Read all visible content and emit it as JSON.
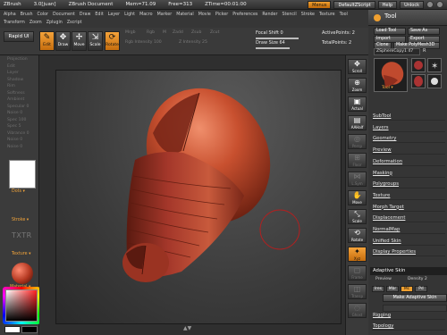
{
  "titlebar": {
    "segments": [
      "ZBrush",
      "3.0[juan]",
      "ZBrush Document",
      "Mem=71.09",
      "Free=313",
      "ZTime=00:01:00"
    ],
    "menus_btn": "Menus",
    "script_btn": "DefaultZScript",
    "help_btn": "Help",
    "unlock_btn": "Unlock"
  },
  "menubar": {
    "items": [
      "Alpha",
      "Brush",
      "Color",
      "Document",
      "Draw",
      "Edit",
      "Layer",
      "Light",
      "Macro",
      "Marker",
      "Material",
      "Movie",
      "Picker",
      "Preferences",
      "Render",
      "Stencil",
      "Stroke",
      "Texture",
      "Tool",
      "Transform",
      "Zoom",
      "Zplugin",
      "Zscript"
    ]
  },
  "shelf": {
    "rapid_ui": "Rapid UI",
    "tools": [
      {
        "label": "Edit",
        "icon": "pencil-icon",
        "glyph": "✎"
      },
      {
        "label": "Draw",
        "icon": "draw-icon",
        "glyph": "✥"
      },
      {
        "label": "Move",
        "icon": "move-icon",
        "glyph": "✢"
      },
      {
        "label": "Scale",
        "icon": "scale-icon",
        "glyph": "⇲"
      },
      {
        "label": "Rotate",
        "icon": "rotate-icon",
        "glyph": "⟳"
      }
    ],
    "dim_labels": [
      "Mrgb",
      "Rgb",
      "M",
      "Zadd",
      "Zsub",
      "Zcut",
      "Rgb Intensity 100",
      "Z Intensity 25"
    ],
    "focal_shift_label": "Focal Shift 0",
    "draw_size_label": "Draw Size 64",
    "active_points_label": "ActivePoints: 2",
    "total_points_label": "TotalPoints: 2"
  },
  "lefttray": {
    "items": [
      "Projection",
      "Edit",
      "Layer",
      "Shadow",
      "Rim",
      "Softness",
      "Ambient",
      "Specular 0",
      "Noise 0",
      "Spec 100",
      "Spec 5",
      "Vibrance 0",
      "Noise 0",
      "Noise 0"
    ],
    "stroke_label": "Stroke ▾",
    "dots_label": "Dots ▾",
    "txtr": "TXTR",
    "texture_label": "Texture ▾",
    "material_label": "Material ▾"
  },
  "rightshelf": {
    "buttons": [
      {
        "label": "Scroll",
        "icon": "scroll-icon",
        "glyph": "✥",
        "active": false,
        "dim": false
      },
      {
        "label": "Zoom",
        "icon": "zoom-icon",
        "glyph": "⊕",
        "active": false,
        "dim": false
      },
      {
        "label": "Actual",
        "icon": "actual-icon",
        "glyph": "▣",
        "active": false,
        "dim": false
      },
      {
        "label": "AAHalf",
        "icon": "aahalf-icon",
        "glyph": "▤",
        "active": false,
        "dim": false
      },
      {
        "label": "Persp",
        "icon": "persp-icon",
        "glyph": "◎",
        "active": false,
        "dim": true
      },
      {
        "label": "Floor",
        "icon": "floor-icon",
        "glyph": "⊞",
        "active": false,
        "dim": true
      },
      {
        "label": "L.Sym",
        "icon": "lsym-icon",
        "glyph": "⋈",
        "active": false,
        "dim": true
      },
      {
        "label": "Move",
        "icon": "move-icon",
        "glyph": "✋",
        "active": false,
        "dim": false
      },
      {
        "label": "Scale",
        "icon": "scale-icon",
        "glyph": "⤡",
        "active": false,
        "dim": false
      },
      {
        "label": "Rotate",
        "icon": "rotate-icon",
        "glyph": "⟲",
        "active": false,
        "dim": false
      },
      {
        "label": "Xyz",
        "icon": "xyz-icon",
        "glyph": "✦",
        "active": true,
        "dim": false
      },
      {
        "label": "Frame",
        "icon": "frame-icon",
        "glyph": "▢",
        "active": false,
        "dim": true
      },
      {
        "label": "Transp",
        "icon": "transp-icon",
        "glyph": "◫",
        "active": false,
        "dim": true
      },
      {
        "label": "Ghost",
        "icon": "ghost-icon",
        "glyph": "◌",
        "active": false,
        "dim": true
      }
    ]
  },
  "toolpalette": {
    "title": "Tool",
    "load_tool": "Load Tool",
    "save_as": "Save As",
    "import": "Import",
    "export": "Export",
    "clone": "Clone",
    "make_polymesh": "Make PolyMesh3D",
    "tool_name": "ZSphereCopy1  47",
    "tool_r": "R",
    "thumb_label": "Tool ▾",
    "subpalettes": [
      "SubTool",
      "Layers",
      "Geometry",
      "Preview",
      "Deformation",
      "Masking",
      "Polygroups",
      "Texture",
      "Morph Target",
      "Displacement",
      "NormalMap",
      "Unified Skin",
      "Display Properties"
    ],
    "adaptive": {
      "header": "Adaptive Skin",
      "preview": "Preview",
      "density": "Density 2",
      "toggles": [
        "Ires",
        "Mbr",
        "Mc",
        "Pd"
      ],
      "make": "Make Adaptive Skin"
    },
    "bottom": [
      "Rigging",
      "Topology"
    ]
  },
  "canvas": {
    "shape_colors": {
      "dark": "#6b1f14",
      "mid": "#b4402a",
      "light": "#d4664a",
      "highlight": "#e88e6e"
    },
    "bottom_arrows": "▲▼"
  }
}
